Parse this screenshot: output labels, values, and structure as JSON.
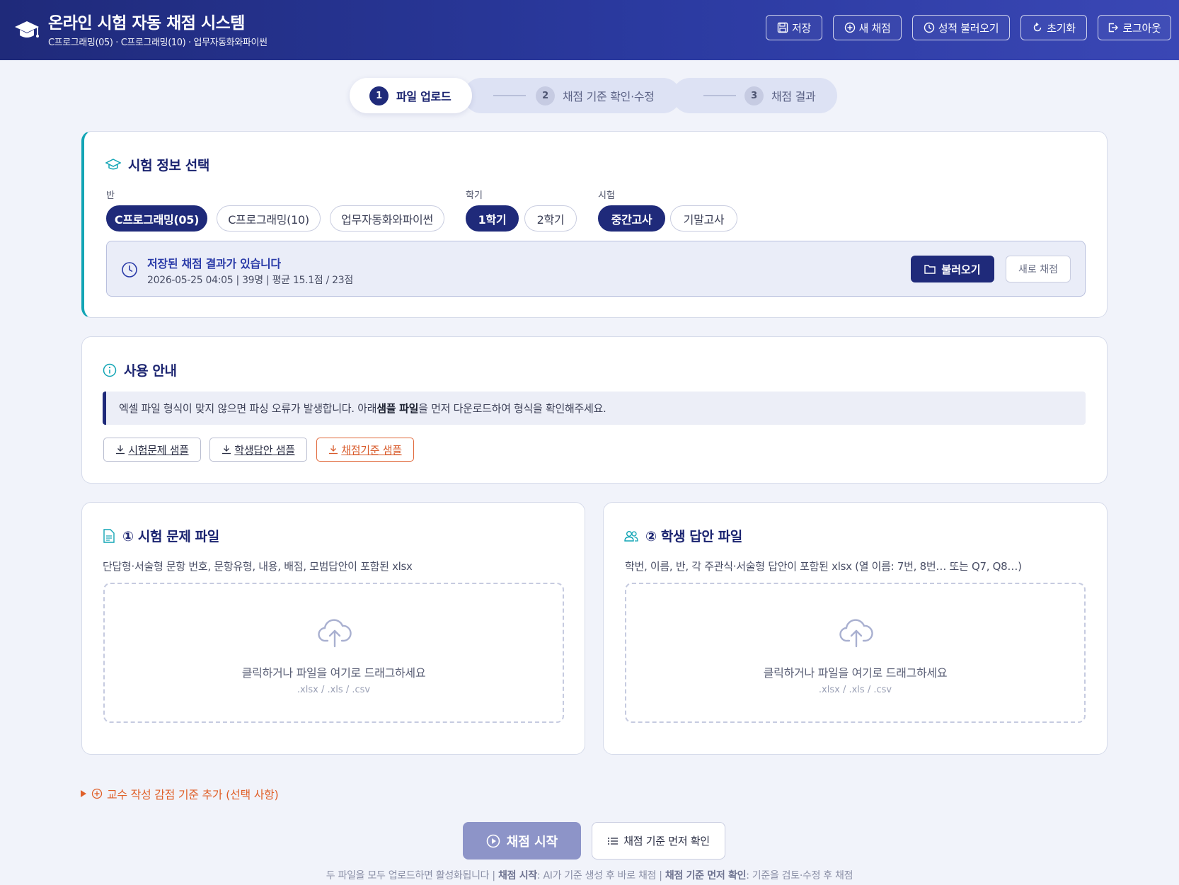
{
  "header": {
    "title": "온라인 시험 자동 채점 시스템",
    "subtitle": "C프로그래밍(05) · C프로그래밍(10) · 업무자동화와파이썬",
    "buttons": [
      {
        "icon": "save-icon",
        "label": "저장"
      },
      {
        "icon": "plus-circle-icon",
        "label": "새 채점"
      },
      {
        "icon": "clock-icon",
        "label": "성적 불러오기"
      },
      {
        "icon": "refresh-icon",
        "label": "초기화"
      },
      {
        "icon": "logout-icon",
        "label": "로그아웃"
      }
    ]
  },
  "stepper": [
    {
      "num": "1",
      "label": "파일 업로드",
      "state": "active"
    },
    {
      "num": "2",
      "label": "채점 기준 확인·수정",
      "state": "inactive"
    },
    {
      "num": "3",
      "label": "채점 결과",
      "state": "inactive"
    }
  ],
  "exam_info": {
    "title": "시험 정보 선택",
    "class_label": "반",
    "classes": [
      "C프로그래밍(05)",
      "C프로그래밍(10)",
      "업무자동화와파이썬"
    ],
    "semester_label": "학기",
    "semesters": [
      "1학기",
      "2학기"
    ],
    "exam_label": "시험",
    "exams": [
      "중간고사",
      "기말고사"
    ],
    "saved": {
      "title": "저장된 채점 결과가 있습니다",
      "meta": "2026-05-25 04:05 | 39명 | 평균 15.1점 / 23점",
      "load_label": "불러오기",
      "new_label": "새로 채점"
    }
  },
  "guide": {
    "title": "사용 안내",
    "notice_pre": "엑셀 파일 형식이 맞지 않으면 파싱 오류가 발생합니다. 아래 ",
    "notice_bold": "샘플 파일",
    "notice_post": "을 먼저 다운로드하여 형식을 확인해주세요.",
    "samples": [
      "시험문제 샘플",
      "학생답안 샘플",
      "채점기준 샘플"
    ]
  },
  "upload_exam": {
    "title": "① 시험 문제 파일",
    "desc": "단답형·서술형 문항 번호, 문항유형, 내용, 배점, 모범답안이 포함된 xlsx",
    "drop_text": "클릭하거나 파일을 여기로 드래그하세요",
    "ext": ".xlsx / .xls / .csv"
  },
  "upload_answer": {
    "title": "② 학생 답안 파일",
    "desc": "학번, 이름, 반, 각 주관식·서술형 답안이 포함된 xlsx (열 이름: 7번, 8번… 또는 Q7, Q8…)",
    "drop_text": "클릭하거나 파일을 여기로 드래그하세요",
    "ext": ".xlsx / .xls / .csv"
  },
  "extra": {
    "label": "교수 작성 감점 기준 추가 (선택 사항)"
  },
  "actions": {
    "start_label": "채점 시작",
    "check_label": "채점 기준 먼저 확인"
  },
  "footer": {
    "part1": "두 파일을 모두 업로드하면 활성화됩니다 | ",
    "bold1": "채점 시작",
    "part2": ": AI가 기준 생성 후 바로 채점 | ",
    "bold2": "채점 기준 먼저 확인",
    "part3": ": 기준을 검토·수정 후 채점"
  },
  "colors": {
    "primary": "#1f2a7a",
    "accent_orange": "#e0602a",
    "teal_bar": "#12a5b5",
    "background": "#f1f3fa"
  }
}
